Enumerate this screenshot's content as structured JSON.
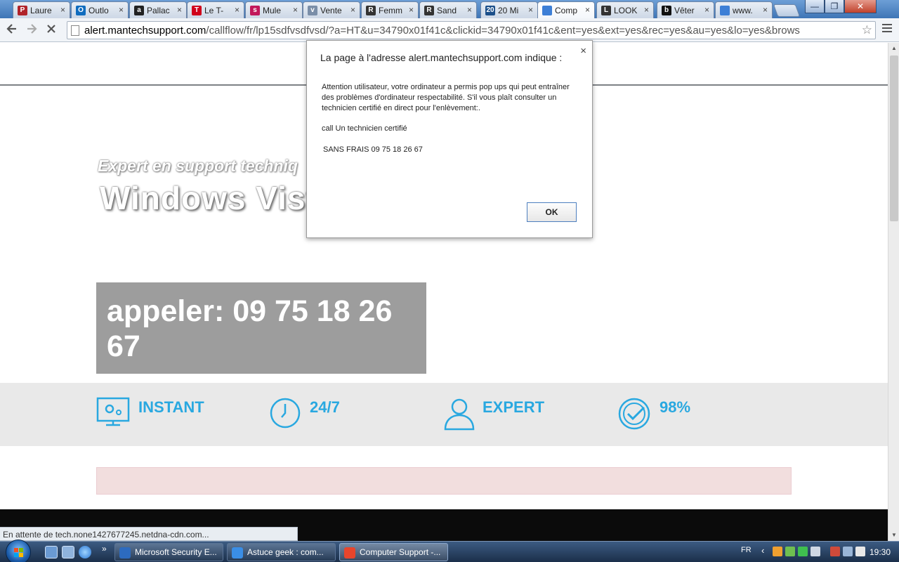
{
  "tabs": [
    {
      "title": "Laure",
      "favicon": "pinterest-icon",
      "color": "#b0232a",
      "letter": "P"
    },
    {
      "title": "Outlo",
      "favicon": "outlook-icon",
      "color": "#0f6cbf",
      "letter": "O"
    },
    {
      "title": "Pallac",
      "favicon": "amazon-icon",
      "color": "#222222",
      "letter": "a"
    },
    {
      "title": "Le T-",
      "favicon": "le-tshirt-icon",
      "color": "#d0021b",
      "letter": "T"
    },
    {
      "title": "Mule",
      "favicon": "mule-icon",
      "color": "#c2185b",
      "letter": "s"
    },
    {
      "title": "Vente",
      "favicon": "vente-icon",
      "color": "#7a8ea8",
      "letter": "v"
    },
    {
      "title": "Femm",
      "favicon": "r-icon",
      "color": "#333333",
      "letter": "R"
    },
    {
      "title": "Sand",
      "favicon": "r-icon",
      "color": "#333333",
      "letter": "R"
    },
    {
      "title": "20 Mi",
      "favicon": "20minutes-icon",
      "color": "#1b4f8a",
      "letter": "20"
    },
    {
      "title": "Comp",
      "favicon": "loading-icon",
      "color": "#3d7fd6",
      "letter": ""
    },
    {
      "title": "LOOK",
      "favicon": "look-icon",
      "color": "#333333",
      "letter": "L"
    },
    {
      "title": "Vêter",
      "favicon": "b-icon",
      "color": "#111111",
      "letter": "b"
    },
    {
      "title": "www.",
      "favicon": "loading-icon",
      "color": "#3d7fd6",
      "letter": ""
    }
  ],
  "window": {
    "minimize": "—",
    "restore": "❐",
    "close": "✕"
  },
  "address": {
    "host": "alert.mantechsupport.com",
    "path": "/callflow/fr/lp15sdfvsdfvsd/?a=HT&u=34790x01f41c&clickid=34790x01f41c&ent=yes&ext=yes&rec=yes&au=yes&lo=yes&brows"
  },
  "page": {
    "hero_subtitle": "Expert en support techniq",
    "hero_title": "Windows Vista",
    "call_text": "appeler: 09 75 18 26 67",
    "features": [
      {
        "label": "INSTANT",
        "icon": "monitor-gear-icon"
      },
      {
        "label": "24/7",
        "icon": "clock-icon"
      },
      {
        "label": "EXPERT",
        "icon": "person-icon"
      },
      {
        "label": "98%",
        "icon": "check-circle-icon"
      }
    ],
    "accent": "#29a8e0"
  },
  "dialog": {
    "title": "La page à l'adresse alert.mantechsupport.com indique :",
    "message": "Attention utilisateur, votre ordinateur a permis pop ups qui peut entraîner des problèmes d'ordinateur respectabilité. S'il vous plaît consulter un technicien certifié en direct pour l'enlèvement:.",
    "line2": "call Un technicien certifié",
    "line3": "SANS FRAIS 09 75 18 26 67",
    "ok": "OK",
    "close": "×"
  },
  "status": "En attente de tech.none1427677245.netdna-cdn.com...",
  "taskbar": {
    "buttons": [
      {
        "label": "Microsoft Security E...",
        "icon": "security-essentials-icon",
        "color": "#2d6bbf"
      },
      {
        "label": "Astuce geek : com...",
        "icon": "ie-icon",
        "color": "#3a8ee6"
      },
      {
        "label": "Computer Support -...",
        "icon": "chrome-icon",
        "color": "#e8452c"
      }
    ],
    "lang": "FR",
    "time": "19:30"
  }
}
